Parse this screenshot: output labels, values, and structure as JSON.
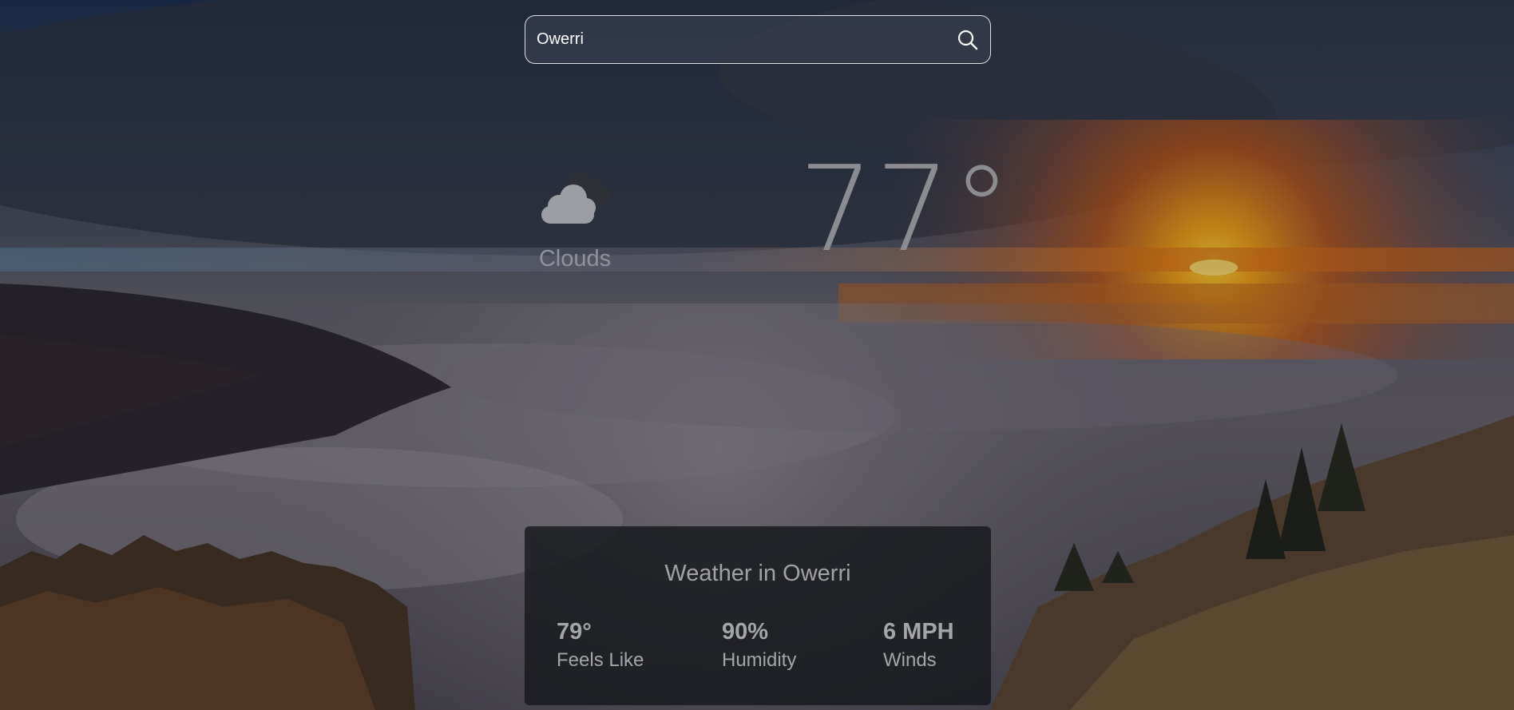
{
  "search": {
    "value": "Owerri",
    "icon": "search-icon"
  },
  "current": {
    "condition": "Clouds",
    "condition_icon": "clouds-icon",
    "temperature": "77°"
  },
  "details": {
    "title": "Weather in Owerri",
    "feels_like": {
      "value": "79°",
      "label": "Feels Like"
    },
    "humidity": {
      "value": "90%",
      "label": "Humidity"
    },
    "winds": {
      "value": "6 MPH",
      "label": "Winds"
    }
  },
  "colors": {
    "sky_top": "#233554",
    "sunset": "#f08a1c",
    "fog": "#8a8896",
    "card_bg": "#16181c"
  }
}
